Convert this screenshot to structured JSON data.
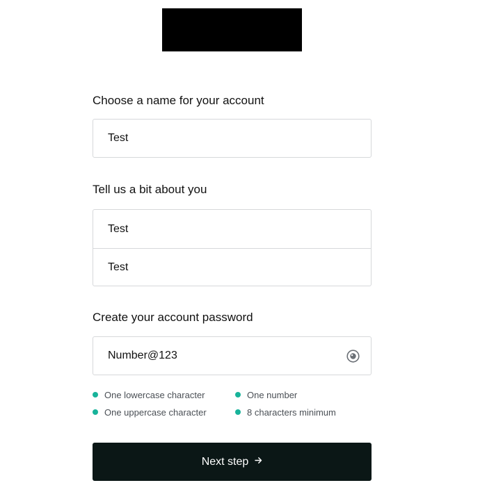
{
  "name_section": {
    "label": "Choose a name for your account",
    "value": "Test"
  },
  "about_section": {
    "label": "Tell us a bit about you",
    "first_value": "Test",
    "second_value": "Test"
  },
  "password_section": {
    "label": "Create your account password",
    "value": "Number@123",
    "toggle_icon": "eye-icon"
  },
  "requirements": [
    {
      "text": "One lowercase character"
    },
    {
      "text": "One number"
    },
    {
      "text": "One uppercase character"
    },
    {
      "text": "8 characters minimum"
    }
  ],
  "requirement_color": "#18b39a",
  "next_button": {
    "label": "Next step",
    "icon": "arrow-right-icon"
  },
  "colors": {
    "button_bg": "#0b1716",
    "border": "#d6d8da",
    "logo": "#000000"
  }
}
